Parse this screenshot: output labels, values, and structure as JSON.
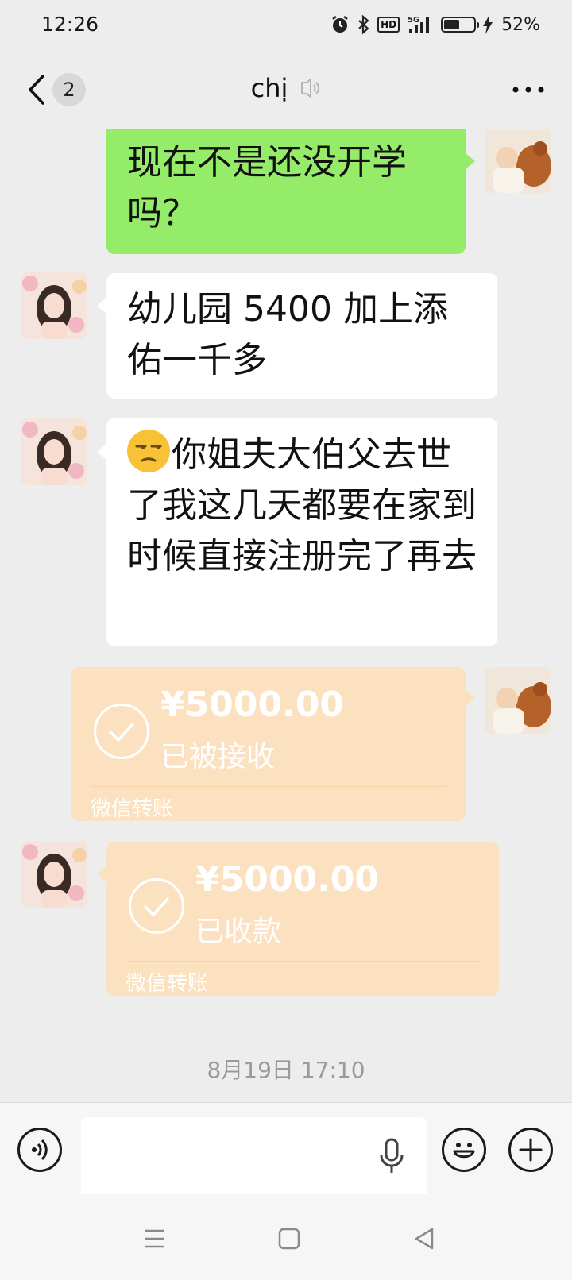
{
  "status_bar": {
    "time": "12:26",
    "hd_label": "HD",
    "network": "5G",
    "battery_percent": "52%",
    "battery_level": 0.52
  },
  "header": {
    "unread_count": "2",
    "title": "chị"
  },
  "messages": [
    {
      "side": "right",
      "type": "text",
      "text": "现在不是还没开学吗？"
    },
    {
      "side": "left",
      "type": "text",
      "text": "幼儿园 5400 加上添佑一千多"
    },
    {
      "side": "left",
      "type": "text",
      "emoji": "unamused-face",
      "text": "你姐夫大伯父去世了我这几天都要在家到时候直接注册完了再去"
    },
    {
      "side": "right",
      "type": "transfer",
      "amount": "¥5000.00",
      "status": "已被接收",
      "footer": "微信转账"
    },
    {
      "side": "left",
      "type": "transfer",
      "amount": "¥5000.00",
      "status": "已收款",
      "footer": "微信转账"
    }
  ],
  "timestamp": "8月19日 17:10",
  "colors": {
    "background": "#ededed",
    "outgoing_bubble": "#95ec69",
    "incoming_bubble": "#ffffff",
    "transfer_card": "#fce1c1"
  }
}
